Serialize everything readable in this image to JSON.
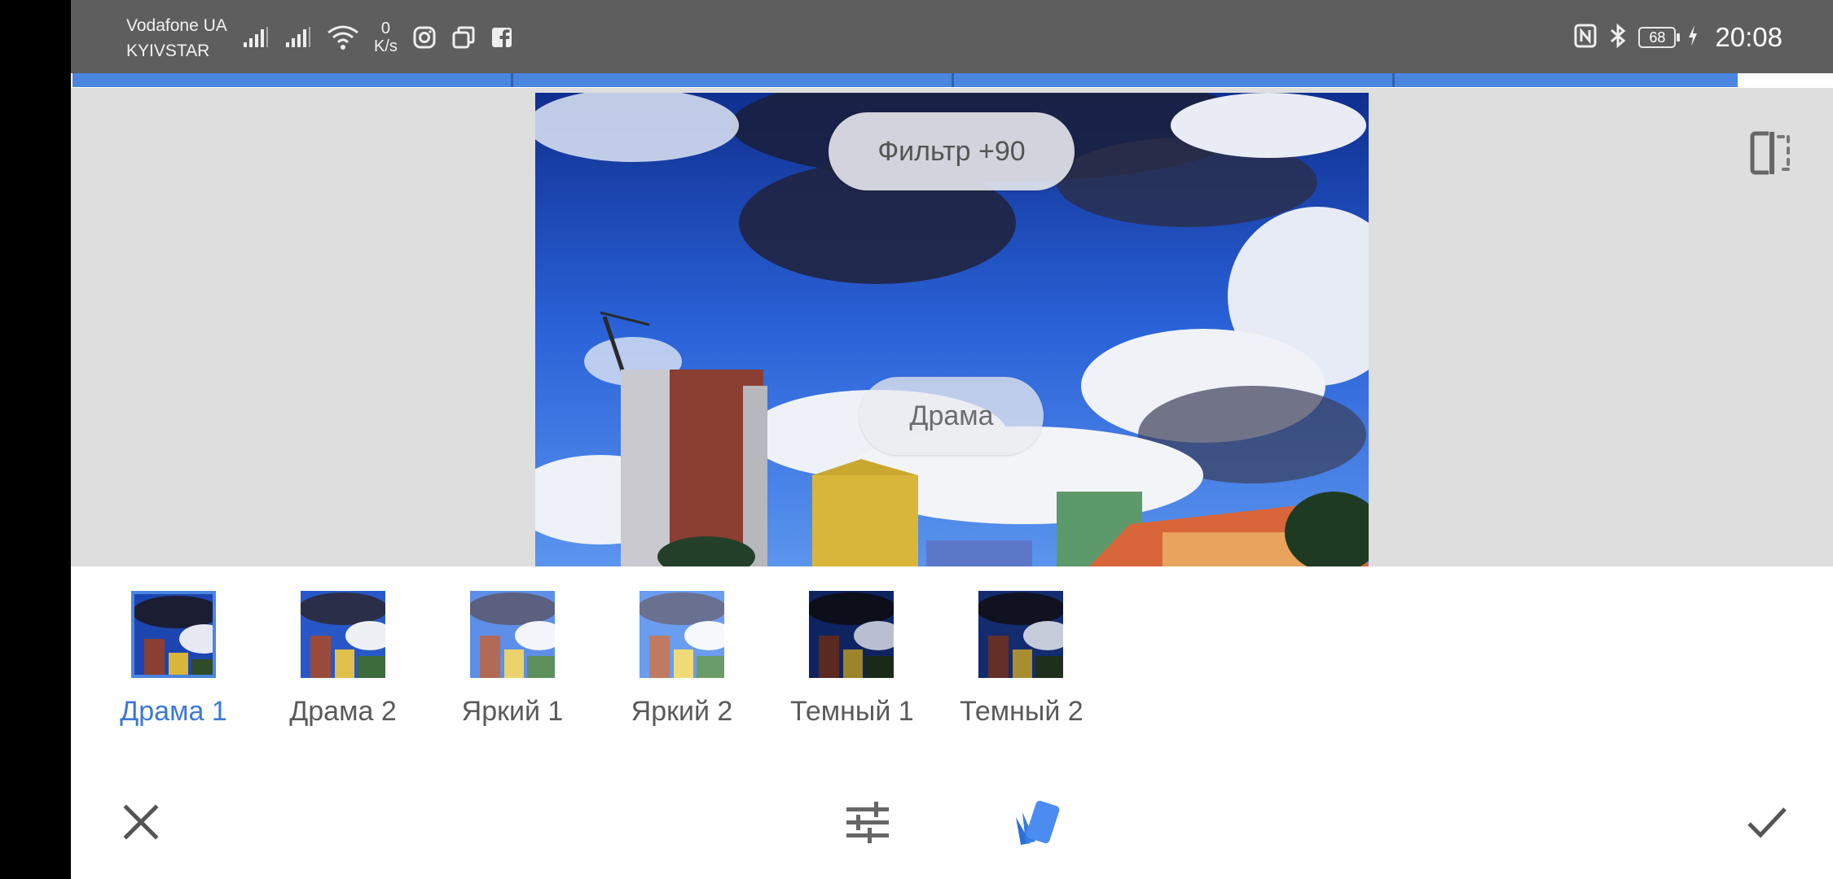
{
  "status_bar": {
    "carrier_1": "Vodafone UA",
    "carrier_2": "KYIVSTAR",
    "net_speed_value": "0",
    "net_speed_unit": "K/s",
    "battery": "68",
    "time": "20:08",
    "icons": [
      "signal-icon",
      "signal-icon",
      "wifi-icon",
      "instagram-icon",
      "app-icon",
      "facebook-icon",
      "nfc-icon",
      "bluetooth-icon",
      "battery-icon",
      "charging-icon"
    ]
  },
  "progress": {
    "fraction": 0.945,
    "segments": 4
  },
  "preview": {
    "filter_badge": "Фильтр +90",
    "style_badge": "Драма",
    "compare_icon": "compare-icon"
  },
  "filters": [
    {
      "label": "Драма 1",
      "selected": true
    },
    {
      "label": "Драма 2",
      "selected": false
    },
    {
      "label": "Яркий 1",
      "selected": false
    },
    {
      "label": "Яркий 2",
      "selected": false
    },
    {
      "label": "Темный 1",
      "selected": false
    },
    {
      "label": "Темный 2",
      "selected": false
    }
  ],
  "toolbar": {
    "cancel_icon": "close-icon",
    "adjust_icon": "tune-icon",
    "styles_icon": "styles-icon",
    "apply_icon": "check-icon"
  },
  "colors": {
    "accent": "#4a86e0",
    "status_bar": "#5e5e5e",
    "preview_bg": "#dedede"
  }
}
